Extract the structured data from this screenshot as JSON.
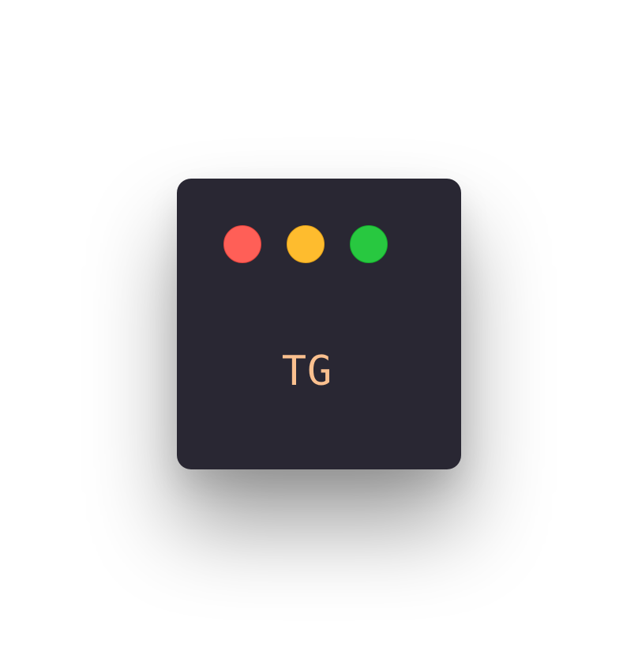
{
  "window": {
    "controls": [
      {
        "name": "close",
        "color": "#ff5f57"
      },
      {
        "name": "minimize",
        "color": "#febc2e"
      },
      {
        "name": "maximize",
        "color": "#28c840"
      }
    ],
    "initials": "TG",
    "initials_color": "#fac08f",
    "background_color": "#292733"
  }
}
